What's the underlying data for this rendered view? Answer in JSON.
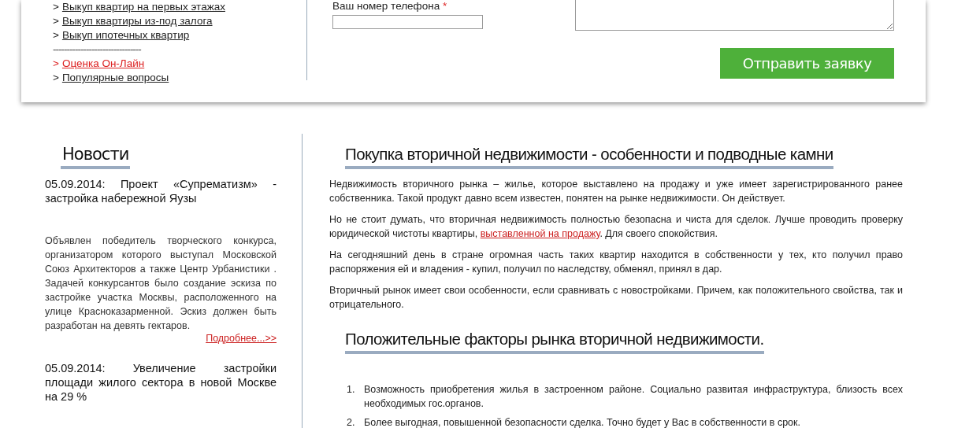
{
  "top_menu": [
    {
      "kind": "link",
      "marker": ">",
      "label": "Выкуп квартир на первых этажах",
      "selected": false
    },
    {
      "kind": "link",
      "marker": ">",
      "label": "Выкуп квартиры из-под залога",
      "selected": false
    },
    {
      "kind": "link",
      "marker": ">",
      "label": "Выкуп ипотечных квартир",
      "selected": false
    },
    {
      "kind": "separator",
      "label": "--------------------------------"
    },
    {
      "kind": "link",
      "marker": ">",
      "label": "Оценка Он-Лайн",
      "selected": true
    },
    {
      "kind": "link",
      "marker": ">",
      "label": "Популярные вопросы",
      "selected": false
    }
  ],
  "form": {
    "phone_label": "Ваш номер телефона",
    "required_mark": "*",
    "submit": "Отправить заявку"
  },
  "news": {
    "title": "Новости",
    "items": [
      {
        "headline": "05.09.2014: Проект «Супрематизм» - застройка набережной Яузы",
        "body": "Объявлен победитель творческого конкурса, организатором которого выступал Московской Союз Архитекторов а также Центр Урбанистики . Задачей конкурсантов было создание эскиза по застройке участка Москвы, расположенного на улице Красноказарменной. Эскиз должен быть разработан на девять гектаров.",
        "more": "Подробнее...>>"
      },
      {
        "headline": "05.09.2014: Увеличение застройки площади жилого сектора в новой Москве на 29 %"
      }
    ]
  },
  "article": {
    "title": "Покупка вторичной недвижимости - особенности и подводные камни",
    "paragraphs": [
      {
        "text": "Недвижимость вторичного рынка – жилье, которое выставлено на продажу и уже имеет зарегистрированного ранее собственника. Такой продукт давно всем известен, понятен на рынке недвижимости. Он действует."
      },
      {
        "text": "Но не стоит думать, что вторичная недвижимость полностью безопасна и чиста для сделок. Лучше проводить проверку юридической чистоты квартиры, ",
        "link": "выставленной на продажу",
        "after": ". Для своего спокойствия."
      },
      {
        "text": "На сегодняшний день в стране огромная часть таких квартир находится в собственности у тех, кто получил право распоряжения ей и владения - купил, получил по наследству, обменял, принял в дар."
      },
      {
        "text": "Вторичный рынок имеет свои особенности, если сравнивать с новостройками. Причем, как положительного свойства, так и отрицательного."
      }
    ],
    "subtitle": "Положительные факторы рынка вторичной недвижимости.",
    "list": [
      {
        "number": "1.",
        "text": "Возможность приобретения жилья в застроенном районе. Социально развитая инфраструктура, близость всех необходимых гос.органов."
      },
      {
        "number": "2.",
        "text": "Более выгодная, повышенной безопасности сделка. Точно будет у Вас в собственности в срок."
      }
    ]
  }
}
